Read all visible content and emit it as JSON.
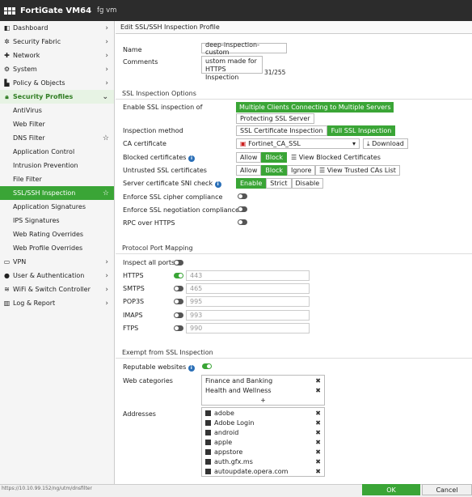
{
  "app": {
    "brand": "FortiGate VM64",
    "vdom": "fg vm"
  },
  "sidebar": [
    {
      "label": "Dashboard",
      "icon": "dashboard",
      "chev": "›"
    },
    {
      "label": "Security Fabric",
      "icon": "fabric",
      "chev": "›"
    },
    {
      "label": "Network",
      "icon": "network",
      "chev": "›"
    },
    {
      "label": "System",
      "icon": "gear",
      "chev": "›"
    },
    {
      "label": "Policy & Objects",
      "icon": "policy",
      "chev": "›"
    },
    {
      "label": "Security Profiles",
      "icon": "lock",
      "chev": "⌄"
    },
    {
      "label": "AntiVirus"
    },
    {
      "label": "Web Filter"
    },
    {
      "label": "DNS Filter",
      "star": "☆"
    },
    {
      "label": "Application Control"
    },
    {
      "label": "Intrusion Prevention"
    },
    {
      "label": "File Filter"
    },
    {
      "label": "SSL/SSH Inspection",
      "star": "☆"
    },
    {
      "label": "Application Signatures"
    },
    {
      "label": "IPS Signatures"
    },
    {
      "label": "Web Rating Overrides"
    },
    {
      "label": "Web Profile Overrides"
    },
    {
      "label": "VPN",
      "icon": "vpn",
      "chev": "›"
    },
    {
      "label": "User & Authentication",
      "icon": "user",
      "chev": "›"
    },
    {
      "label": "WiFi & Switch Controller",
      "icon": "wifi",
      "chev": "›"
    },
    {
      "label": "Log & Report",
      "icon": "chart",
      "chev": "›"
    }
  ],
  "form": {
    "title": "Edit SSL/SSH Inspection Profile",
    "name_label": "Name",
    "name_value": "deep-inspection-custom",
    "comments_label": "Comments",
    "comments_value": "ustom made for HTTPS Inspection",
    "comments_count": "31/255"
  },
  "ssl": {
    "header": "SSL Inspection Options",
    "enable_label": "Enable SSL inspection of",
    "enable_opt1": "Multiple Clients Connecting to Multiple Servers",
    "enable_opt2": "Protecting SSL Server",
    "method_label": "Inspection method",
    "method_opt1": "SSL Certificate Inspection",
    "method_opt2": "Full SSL Inspection",
    "ca_label": "CA certificate",
    "ca_value": "Fortinet_CA_SSL",
    "download": "Download",
    "blocked_label": "Blocked certificates",
    "allow": "Allow",
    "block": "Block",
    "ignore": "Ignore",
    "view_blocked": "View Blocked Certificates",
    "untrusted_label": "Untrusted SSL certificates",
    "view_trusted": "View Trusted CAs List",
    "sni_label": "Server certificate SNI check",
    "enable": "Enable",
    "strict": "Strict",
    "disable": "Disable",
    "cipher_label": "Enforce SSL cipher compliance",
    "negotiation_label": "Enforce SSL negotiation compliance",
    "rpc_label": "RPC over HTTPS"
  },
  "ports": {
    "header": "Protocol Port Mapping",
    "inspect_all": "Inspect all ports",
    "items": [
      {
        "label": "HTTPS",
        "value": "443",
        "on": true
      },
      {
        "label": "SMTPS",
        "value": "465",
        "on": false
      },
      {
        "label": "POP3S",
        "value": "995",
        "on": false
      },
      {
        "label": "IMAPS",
        "value": "993",
        "on": false
      },
      {
        "label": "FTPS",
        "value": "990",
        "on": false
      }
    ]
  },
  "exempt": {
    "header": "Exempt from SSL Inspection",
    "reputable_label": "Reputable websites",
    "webcat_label": "Web categories",
    "webcats": [
      "Finance and Banking",
      "Health and Wellness"
    ],
    "add": "+",
    "addresses_label": "Addresses",
    "addresses": [
      "adobe",
      "Adobe Login",
      "android",
      "apple",
      "appstore",
      "auth.gfx.ms",
      "autoupdate.opera.com"
    ]
  },
  "footer": {
    "status_url": "https://10.10.99.152/ng/utm/dnsfilter",
    "ok": "OK",
    "cancel": "Cancel"
  }
}
